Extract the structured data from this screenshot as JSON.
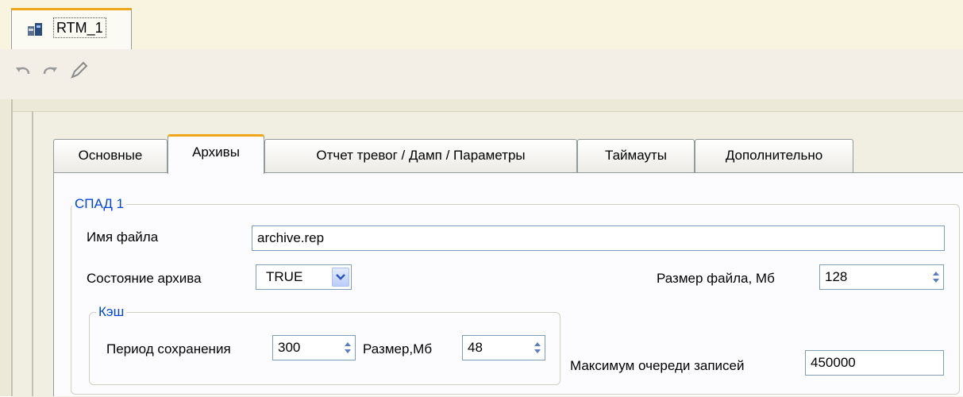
{
  "document_tab": {
    "title": "RTM_1"
  },
  "toolbar": {
    "undo_icon": "undo-icon",
    "redo_icon": "redo-icon",
    "edit_icon": "edit-pen-icon"
  },
  "tabs": [
    {
      "label": "Основные"
    },
    {
      "label": "Архивы"
    },
    {
      "label": "Отчет тревог / Дамп / Параметры"
    },
    {
      "label": "Таймауты"
    },
    {
      "label": "Дополнительно"
    }
  ],
  "active_tab": "Архивы",
  "group_spad": {
    "legend": "СПАД 1",
    "file_name_label": "Имя файла",
    "file_name_value": "archive.rep",
    "archive_state_label": "Состояние архива",
    "archive_state_value": "TRUE",
    "file_size_label": "Размер файла, Мб",
    "file_size_value": "128",
    "max_queue_label": "Максимум очереди записей",
    "max_queue_value": "450000"
  },
  "group_cache": {
    "legend": "Кэш",
    "save_period_label": "Период сохранения",
    "save_period_value": "300",
    "size_label": "Размер,Мб",
    "size_value": "48"
  },
  "colors": {
    "tab_accent": "#f0a51a",
    "legend_text": "#0046d5",
    "field_border": "#7f9db9"
  }
}
